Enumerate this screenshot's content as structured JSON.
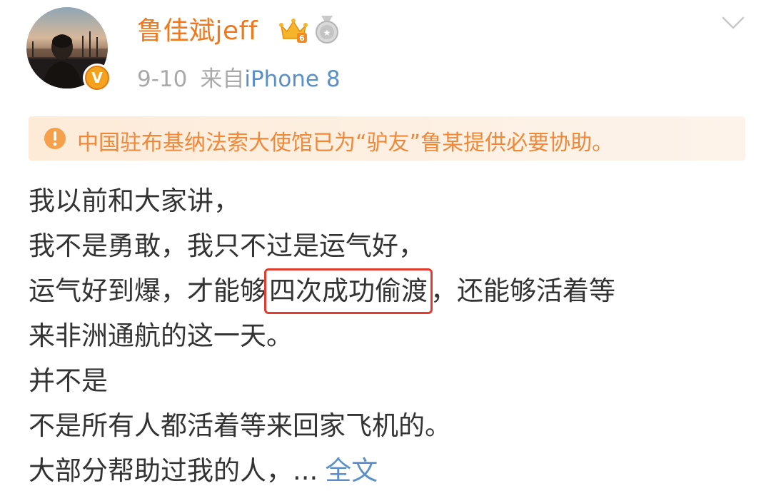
{
  "post": {
    "author": "鲁佳斌jeff",
    "date": "9-10",
    "source_prefix": "来自",
    "source_device": "iPhone 8",
    "vip_mark": "V",
    "member_icon": "vip-crown-icon",
    "medal_icon": "medal-icon",
    "notice": {
      "icon": "exclamation-circle-icon",
      "text": "中国驻布基纳法索大使馆已为“驴友”鲁某提供必要协助。"
    },
    "lines": [
      "我以前和大家讲，",
      "我不是勇敢，我只不过是运气好，"
    ],
    "line3": {
      "before": "运气好到爆，才能够",
      "highlight": "四次成功偷渡",
      "after": "，还能够活着等"
    },
    "lines_after": [
      "来非洲通航的这一天。",
      "并不是",
      "不是所有人都活着等来回家飞机的。"
    ],
    "last_line": {
      "text": "大部分帮助过我的人，...",
      "link": "全文"
    }
  },
  "colors": {
    "username": "#f0791d",
    "link": "#5b8fc7",
    "meta_gray": "#a9a9a9",
    "notice_text": "#f0883a",
    "notice_bg": "#fdebd8",
    "highlight_border": "#e23b2f"
  }
}
